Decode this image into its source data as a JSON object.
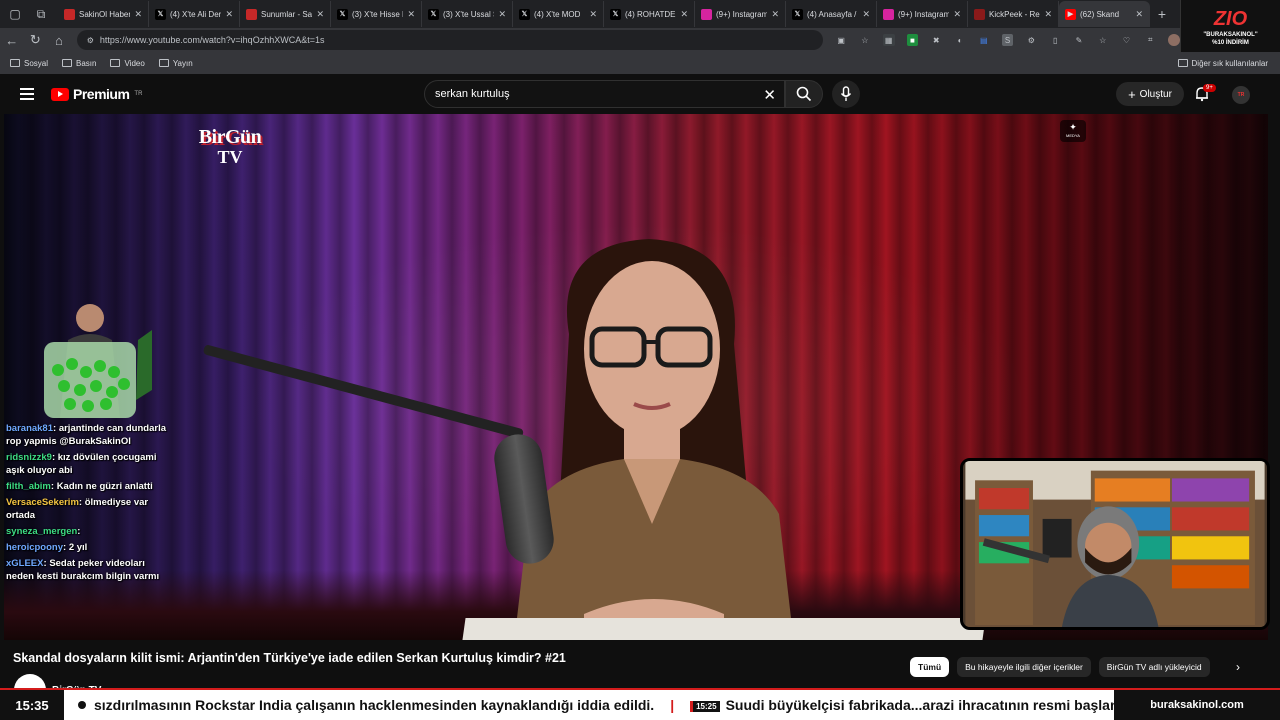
{
  "browser": {
    "tabs": [
      {
        "label": "SakinOl Haber",
        "icon": "sakinol-icon",
        "color": "#c62828"
      },
      {
        "label": "(4) X'te Ali Der",
        "icon": "x-icon",
        "color": "#000000"
      },
      {
        "label": "Sunumlar - Sak",
        "icon": "sakinol-icon",
        "color": "#c62828"
      },
      {
        "label": "(3) X'te Hisse P",
        "icon": "x-icon",
        "color": "#000000"
      },
      {
        "label": "(3) X'te Ussal S",
        "icon": "x-icon",
        "color": "#000000"
      },
      {
        "label": "(4) X'te MOD",
        "icon": "x-icon",
        "color": "#000000"
      },
      {
        "label": "(4) ROHATDEM",
        "icon": "x-icon",
        "color": "#000000"
      },
      {
        "label": "(9+) Instagram",
        "icon": "instagram-icon",
        "color": "#d6249f"
      },
      {
        "label": "(4) Anasayfa /",
        "icon": "x-icon",
        "color": "#000000"
      },
      {
        "label": "(9+) Instagram",
        "icon": "instagram-icon",
        "color": "#d6249f"
      },
      {
        "label": "KickPeek - Rea",
        "icon": "kickpeek-icon",
        "color": "#8b1a1a"
      },
      {
        "label": "(62) Skand",
        "icon": "youtube-icon",
        "color": "#ff0000"
      }
    ],
    "url": "https://www.youtube.com/watch?v=ihqOzhhXWCA&t=1s",
    "bookmarks": [
      "Sosyal",
      "Basın",
      "Video",
      "Yayın"
    ],
    "other_bookmarks": "Diğer sık kullanılanlar"
  },
  "ad": {
    "brand": "ZIO",
    "line1": "\"BURAKSAKINOL\"",
    "line2": "%10 İNDİRİM"
  },
  "youtube": {
    "logo_text": "Premium",
    "region": "TR",
    "search_value": "serkan kurtuluş",
    "create_label": "Oluştur",
    "notification_count": "9+",
    "avatar_text": "TR"
  },
  "video": {
    "channel_logo_line1": "BirGün",
    "channel_logo_line2": "TV",
    "sponsor_badge": "MEDYA",
    "title": "Skandal dosyaların kilit ismi: Arjantin'den Türkiye'ye iade edilen Serkan Kurtuluş kimdir? #21",
    "channel_name": "BirGün TV"
  },
  "chips": [
    "Tümü",
    "Bu hikayeyle ilgili diğer içerikler",
    "BirGün TV adlı yükleyicid"
  ],
  "chat": [
    {
      "user": "baranak81",
      "color": "#6fa8ff",
      "text": "arjantinde can dundarla rop yapmis @BurakSakinOl"
    },
    {
      "user": "ridsnizzk9",
      "color": "#3ddc84",
      "text": "kız dövülen çocugami aşık oluyor abi"
    },
    {
      "user": "filth_abim",
      "color": "#3ddc84",
      "text": "Kadın ne güzri anlatti"
    },
    {
      "user": "VersaceSekerim",
      "color": "#f4c542",
      "text": "ölmediyse var ortada"
    },
    {
      "user": "syneza_mergen",
      "color": "#3ddc84",
      "text": ""
    },
    {
      "user": "heroicpoony",
      "color": "#6fa8ff",
      "text": "2 yıl"
    },
    {
      "user": "xGLEEX",
      "color": "#6fa8ff",
      "text": "Sedat peker videoları neden kesti burakcım bilgin varmı"
    }
  ],
  "ticker": {
    "time": "15:35",
    "text1": "sızdırılmasının Rockstar India çalışanın hacklenmesinden kaynaklandığı iddia edildi.",
    "mini_time": "15:25",
    "text2": "Suudi büyükelçisi fabrikada...arazi ihracatının resmi başlangıç",
    "site": "buraksakinol.com"
  },
  "colors": {
    "accent": "#ff0000",
    "ticker_red": "#d41c1c"
  }
}
